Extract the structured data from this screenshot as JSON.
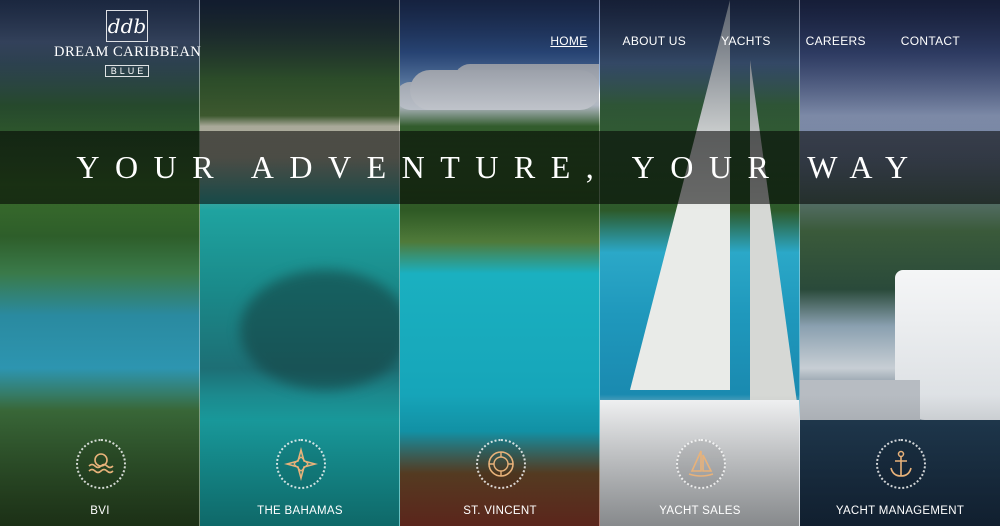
{
  "brand": {
    "monogram": "ddb",
    "name": "DREAM CARIBBEAN",
    "sub": "BLUE"
  },
  "nav": {
    "items": [
      {
        "label": "HOME",
        "active": true
      },
      {
        "label": "ABOUT US",
        "active": false
      },
      {
        "label": "YACHTS",
        "active": false
      },
      {
        "label": "CAREERS",
        "active": false
      },
      {
        "label": "CONTACT",
        "active": false
      }
    ]
  },
  "hero": {
    "headline": "YOUR ADVENTURE, YOUR WAY"
  },
  "tiles": [
    {
      "label": "BVI",
      "icon": "waves-sun-icon"
    },
    {
      "label": "THE BAHAMAS",
      "icon": "compass-star-icon"
    },
    {
      "label": "ST. VINCENT",
      "icon": "shell-icon"
    },
    {
      "label": "YACHT SALES",
      "icon": "sailboat-icon"
    },
    {
      "label": "YACHT MANAGEMENT",
      "icon": "anchor-icon"
    }
  ],
  "colors": {
    "icon_accent": "#e8b27a",
    "text": "#ffffff"
  }
}
